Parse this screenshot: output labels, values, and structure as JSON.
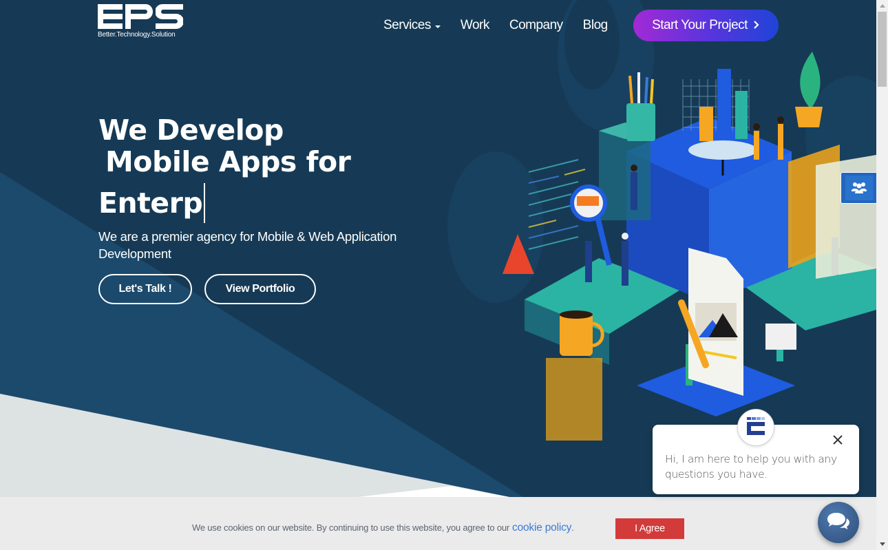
{
  "brand": {
    "logo_text": "EPS",
    "tagline": "Better.Technology.Solution"
  },
  "nav": {
    "items": [
      {
        "label": "Services",
        "has_dropdown": true
      },
      {
        "label": "Work",
        "has_dropdown": false
      },
      {
        "label": "Company",
        "has_dropdown": false
      },
      {
        "label": "Blog",
        "has_dropdown": false
      }
    ],
    "cta_label": "Start Your Project",
    "cta_icon": "chevron-right-icon"
  },
  "hero": {
    "headline_line1": "We Develop",
    "headline_line2": "Mobile Apps for",
    "headline_typing": "Enterp",
    "subtitle": "We are a premier agency for Mobile & Web Application Development",
    "buttons": {
      "talk": "Let's Talk !",
      "portfolio": "View Portfolio"
    },
    "illustration": "isometric-teamwork-illustration"
  },
  "side_widget": {
    "icon": "users-group-icon"
  },
  "chat": {
    "message": "Hi, I am here to help you with any questions you have.",
    "close_icon": "close-icon",
    "avatar_icon": "eps-logo-icon",
    "fab_icon": "chat-bubbles-icon"
  },
  "cookie": {
    "text": "We use cookies on our website. By continuing to use this website, you agree to our",
    "link_text": "cookie policy",
    "suffix": ".",
    "agree_label": "I Agree"
  },
  "colors": {
    "hero_bg": "#163a55",
    "cta_gradient_start": "#a22ad6",
    "cta_gradient_end": "#1f44d8",
    "agree_button": "#d33a3a",
    "cookie_link": "#3a7bd5",
    "chat_fab": "#3b5f8e"
  }
}
